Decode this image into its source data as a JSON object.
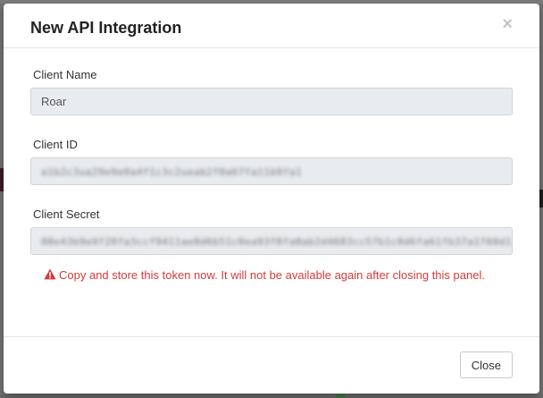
{
  "modal": {
    "title": "New API Integration",
    "close_symbol": "×"
  },
  "fields": {
    "client_name": {
      "label": "Client Name",
      "value": "Roar"
    },
    "client_id": {
      "label": "Client ID",
      "value": "a1b2c3ua29e9e0a4f1c3c2ueab2f0a67fa11b9fa1"
    },
    "client_secret": {
      "label": "Client Secret",
      "value": "08e43b9e9f20fa3ccf9411ae8d6b51c0ea93f0fa8ab2d4683cc57b1c0d6fa61fb37a1f60d1"
    }
  },
  "warning": {
    "text": "Copy and store this token now. It will not be available again after closing this panel.",
    "color": "#d63a3a",
    "icon": "warning-triangle-icon"
  },
  "footer": {
    "close_label": "Close"
  }
}
